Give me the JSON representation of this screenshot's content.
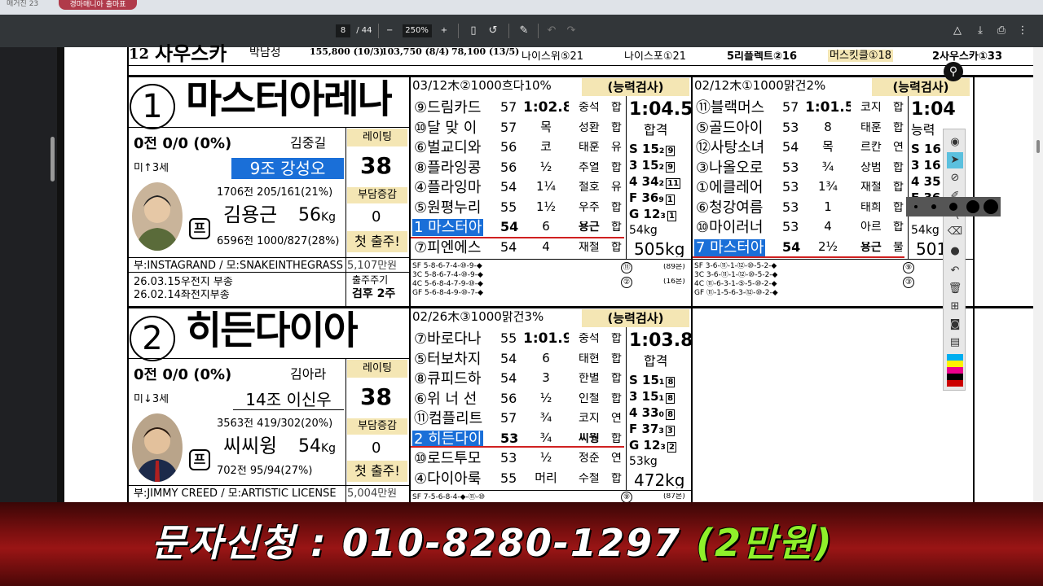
{
  "browser": {
    "tab_title": "경마매니아 출마표",
    "left_text": "매거진 23"
  },
  "toolbar": {
    "page_current": "8",
    "page_total": "/ 44",
    "zoom": "250%",
    "minus": "−",
    "plus": "+"
  },
  "top_row": {
    "num": "12",
    "name": "사우스카",
    "trainer": "박남성",
    "rec1": "155,800 (10/3)",
    "rec2": "103,750 (8/4)",
    "rec3": "78,100 (13/5)",
    "h1": "나이스위⑤21",
    "h2": "나이스포①21",
    "h3": "5리플렉트②16",
    "h4": "머스킷클①18",
    "h5": "2사우스카①33"
  },
  "horse1": {
    "num": "1",
    "name": "마스터아레나",
    "record": "0전 0/0 (0%)",
    "owner": "김중길",
    "rating_label": "레이팅",
    "rating": "38",
    "origin": "미",
    "sex_age": "3세",
    "group_jockey": "9조 강성오",
    "trainer_stats": "1706전 205/161(21%)",
    "trainer": "김용근",
    "weight": "56",
    "weight_unit": "Kg",
    "burden_label": "부담증감",
    "burden": "0",
    "tag": "프",
    "jockey_stats": "6596전 1000/827(28%)",
    "first_label": "첫 출주!",
    "parents": "부:INSTAGRAND / 모:SNAKEINTHEGRASS",
    "prize": "5,107만원",
    "hist1": "26.03.15우전지 부종",
    "hist2": "26.02.14좌전지부종",
    "status_label": "출주주기",
    "status": "검후 2주",
    "race_a": {
      "header": "03/12木②1000흐다10%",
      "test": "(능력검사)",
      "time_big": "1:04.5",
      "result": "합격",
      "kg": "54kg",
      "weight_big": "505kg",
      "rows": [
        {
          "name": "⑨드림카드",
          "w": "57",
          "gap": "1:02.8",
          "j": "중석",
          "r": "합"
        },
        {
          "name": "⑩달 맞 이",
          "w": "57",
          "gap": "목",
          "j": "성환",
          "r": "합"
        },
        {
          "name": "⑥벌교디와",
          "w": "56",
          "gap": "코",
          "j": "태훈",
          "r": "유"
        },
        {
          "name": "⑧플라잉콩",
          "w": "56",
          "gap": "½",
          "j": "추열",
          "r": "합"
        },
        {
          "name": "④플라잉마",
          "w": "54",
          "gap": "1¼",
          "j": "철호",
          "r": "유"
        },
        {
          "name": "⑤원평누리",
          "w": "55",
          "gap": "1½",
          "j": "우주",
          "r": "합"
        },
        {
          "name": "1 마스터아",
          "w": "54",
          "gap": "6",
          "j": "용근",
          "r": "합"
        },
        {
          "name": "⑦피엔에스",
          "w": "54",
          "gap": "4",
          "j": "재철",
          "r": "합"
        }
      ],
      "stats": [
        {
          "k": "S",
          "v": "15₂",
          "b": "9"
        },
        {
          "k": "3",
          "v": "15₂",
          "b": "9"
        },
        {
          "k": "4",
          "v": "34₂",
          "b": "11"
        },
        {
          "k": "F",
          "v": "36₉",
          "b": "1"
        },
        {
          "k": "G",
          "v": "12₃",
          "b": "1"
        }
      ],
      "sf": [
        "SF 5-8-6-7-4-⑩-9-◆",
        "3C 5-8-6-7-4-⑩-9-◆",
        "4C 5-6-8-4-7-9-⑩-◆",
        "GF 5-6-8-4-9-⑩-7-◆"
      ],
      "sf_mark1": "⑪",
      "sf_mark2": "②",
      "sf_note1": "(89본)",
      "sf_note2": "(16본)"
    },
    "race_b": {
      "header": "02/12木①1000맑건2%",
      "test": "(능력검사)",
      "time_big": "1:04",
      "result": "능력",
      "kg": "54kg",
      "weight_big": "501",
      "rows": [
        {
          "name": "⑪블랙머스",
          "w": "57",
          "gap": "1:01.5",
          "j": "코지",
          "r": "합"
        },
        {
          "name": "⑤골드아이",
          "w": "53",
          "gap": "8",
          "j": "태훈",
          "r": "합"
        },
        {
          "name": "⑫사탕소녀",
          "w": "54",
          "gap": "목",
          "j": "르칸",
          "r": "연"
        },
        {
          "name": "③나올오로",
          "w": "53",
          "gap": "¾",
          "j": "상범",
          "r": "합"
        },
        {
          "name": "①에클레어",
          "w": "53",
          "gap": "1¾",
          "j": "재철",
          "r": "합"
        },
        {
          "name": "⑥청강여름",
          "w": "53",
          "gap": "1",
          "j": "태희",
          "r": "합"
        },
        {
          "name": "⑩마이러너",
          "w": "53",
          "gap": "4",
          "j": "아르",
          "r": "합"
        },
        {
          "name": "7 마스터아",
          "w": "54",
          "gap": "2½",
          "j": "용근",
          "r": "불"
        }
      ],
      "stats": [
        {
          "k": "S",
          "v": "16"
        },
        {
          "k": "3",
          "v": "16"
        },
        {
          "k": "4",
          "v": "35"
        },
        {
          "k": "F",
          "v": "36"
        }
      ],
      "sf": [
        "SF 3-6-⑪-1-⑫-⑩-5-2-◆",
        "3C 3-6-⑪-1-⑫-⑩-5-2-◆",
        "4C ⑪-6-3-1-⑤-5-⑩-2-◆",
        "GF ⑪-1-5-6-3-⑫-⑩-2-◆"
      ],
      "sf_mark1": "⑨",
      "sf_mark2": "③"
    }
  },
  "horse2": {
    "num": "2",
    "name": "히든다이아",
    "record": "0전 0/0 (0%)",
    "owner": "김아라",
    "rating_label": "레이팅",
    "rating": "38",
    "origin": "미",
    "sex_age": "3세",
    "group_jockey": "14조 이신우",
    "trainer_stats": "3563전 419/302(20%)",
    "trainer": "씨씨윙",
    "weight": "54",
    "weight_unit": "Kg",
    "burden_label": "부담증감",
    "burden": "0",
    "tag": "프",
    "jockey_stats": "702전 95/94(27%)",
    "first_label": "첫 출주!",
    "parents": "부:JIMMY CREED / 모:ARTISTIC LICENSE",
    "prize": "5,004만원",
    "race_a": {
      "header": "02/26木③1000맑건3%",
      "test": "(능력검사)",
      "time_big": "1:03.8",
      "result": "합격",
      "kg": "53kg",
      "weight_big": "472kg",
      "rows": [
        {
          "name": "⑦바로다나",
          "w": "55",
          "gap": "1:01.9",
          "j": "중석",
          "r": "합"
        },
        {
          "name": "⑤터보차지",
          "w": "54",
          "gap": "6",
          "j": "태현",
          "r": "합"
        },
        {
          "name": "⑧큐피드하",
          "w": "54",
          "gap": "3",
          "j": "한별",
          "r": "합"
        },
        {
          "name": "⑥위 너 선",
          "w": "56",
          "gap": "½",
          "j": "인철",
          "r": "합"
        },
        {
          "name": "⑪컴플리트",
          "w": "57",
          "gap": "¾",
          "j": "코지",
          "r": "연"
        },
        {
          "name": "2 히든다이",
          "w": "53",
          "gap": "¾",
          "j": "씨웡",
          "r": "합"
        },
        {
          "name": "⑩로드투모",
          "w": "53",
          "gap": "½",
          "j": "정준",
          "r": "연"
        },
        {
          "name": "④다이아룩",
          "w": "55",
          "gap": "머리",
          "j": "수철",
          "r": "합"
        }
      ],
      "stats": [
        {
          "k": "S",
          "v": "15₁",
          "b": "8"
        },
        {
          "k": "3",
          "v": "15₁",
          "b": "8"
        },
        {
          "k": "4",
          "v": "33₀",
          "b": "8"
        },
        {
          "k": "F",
          "v": "37₃",
          "b": "3"
        },
        {
          "k": "G",
          "v": "12₃",
          "b": "2"
        }
      ],
      "sf": [
        "SF 7-5-6-8-4-◆-⑪-⑩"
      ],
      "sf_mark1": "⑨",
      "sf_note1": "(87본)"
    }
  },
  "banner": {
    "main": "문자신청 : 010-8280-1297",
    "accent": "(2만원)"
  }
}
